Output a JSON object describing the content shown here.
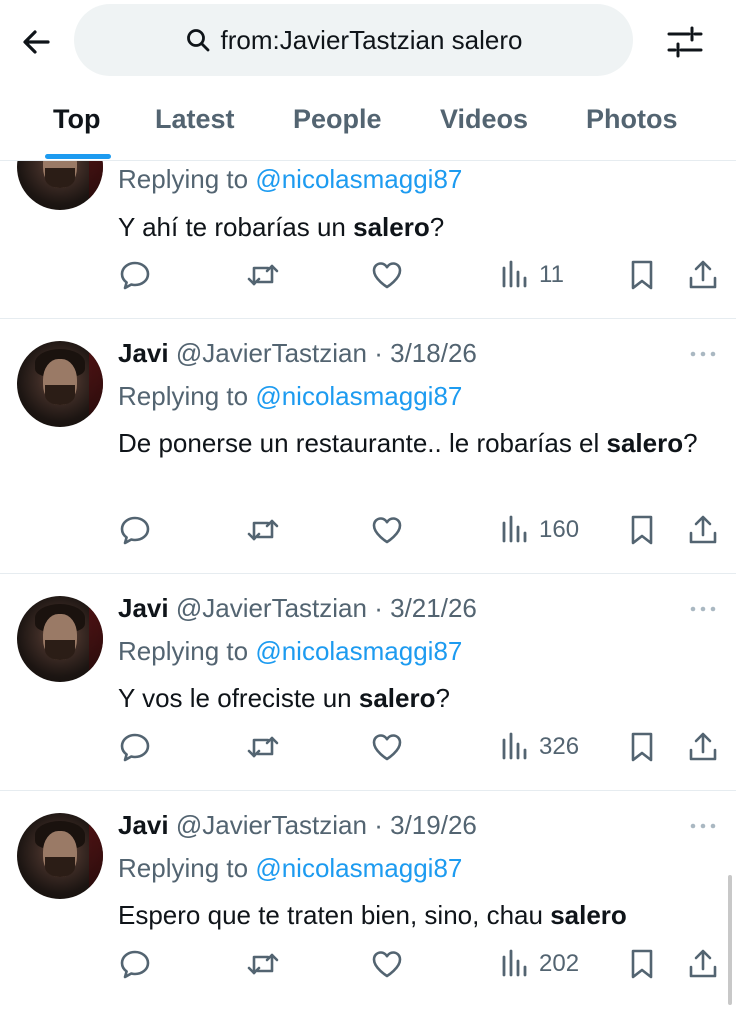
{
  "search": {
    "query": "from:JavierTastzian salero"
  },
  "tabs": [
    {
      "label": "Top"
    },
    {
      "label": "Latest"
    },
    {
      "label": "People"
    },
    {
      "label": "Videos"
    },
    {
      "label": "Photos"
    }
  ],
  "tweets": [
    {
      "reply_prefix": "Replying to",
      "reply_to": "@nicolasmaggi87",
      "text_before": "Y ahí te robarías un ",
      "text_bold": "salero",
      "text_after": "?",
      "views": "11"
    },
    {
      "name": "Javi",
      "handle": "@JavierTastzian",
      "separator": "·",
      "date": "3/18/26",
      "reply_prefix": "Replying to",
      "reply_to": "@nicolasmaggi87",
      "text_before": "De ponerse un restaurante.. le robarías el ",
      "text_bold": "salero",
      "text_after": "?",
      "views": "160"
    },
    {
      "name": "Javi",
      "handle": "@JavierTastzian",
      "separator": "·",
      "date": "3/21/26",
      "reply_prefix": "Replying to",
      "reply_to": "@nicolasmaggi87",
      "text_before": "Y vos le ofreciste un ",
      "text_bold": "salero",
      "text_after": "?",
      "views": "326"
    },
    {
      "name": "Javi",
      "handle": "@JavierTastzian",
      "separator": "·",
      "date": "3/19/26",
      "reply_prefix": "Replying to",
      "reply_to": "@nicolasmaggi87",
      "text_before": "Espero que te traten bien, sino, chau ",
      "text_bold": "salero",
      "text_after": "",
      "views": "202"
    }
  ],
  "icons": {
    "back": "arrow-left-icon",
    "search": "search-icon",
    "filter": "sliders-icon",
    "reply": "reply-bubble-icon",
    "retweet": "retweet-icon",
    "like": "heart-icon",
    "views": "views-bar-chart-icon",
    "bookmark": "bookmark-icon",
    "share": "share-icon",
    "more": "more-dots-icon"
  },
  "colors": {
    "accent": "#1d9bf0",
    "text": "#0f1419",
    "secondary": "#536471"
  }
}
